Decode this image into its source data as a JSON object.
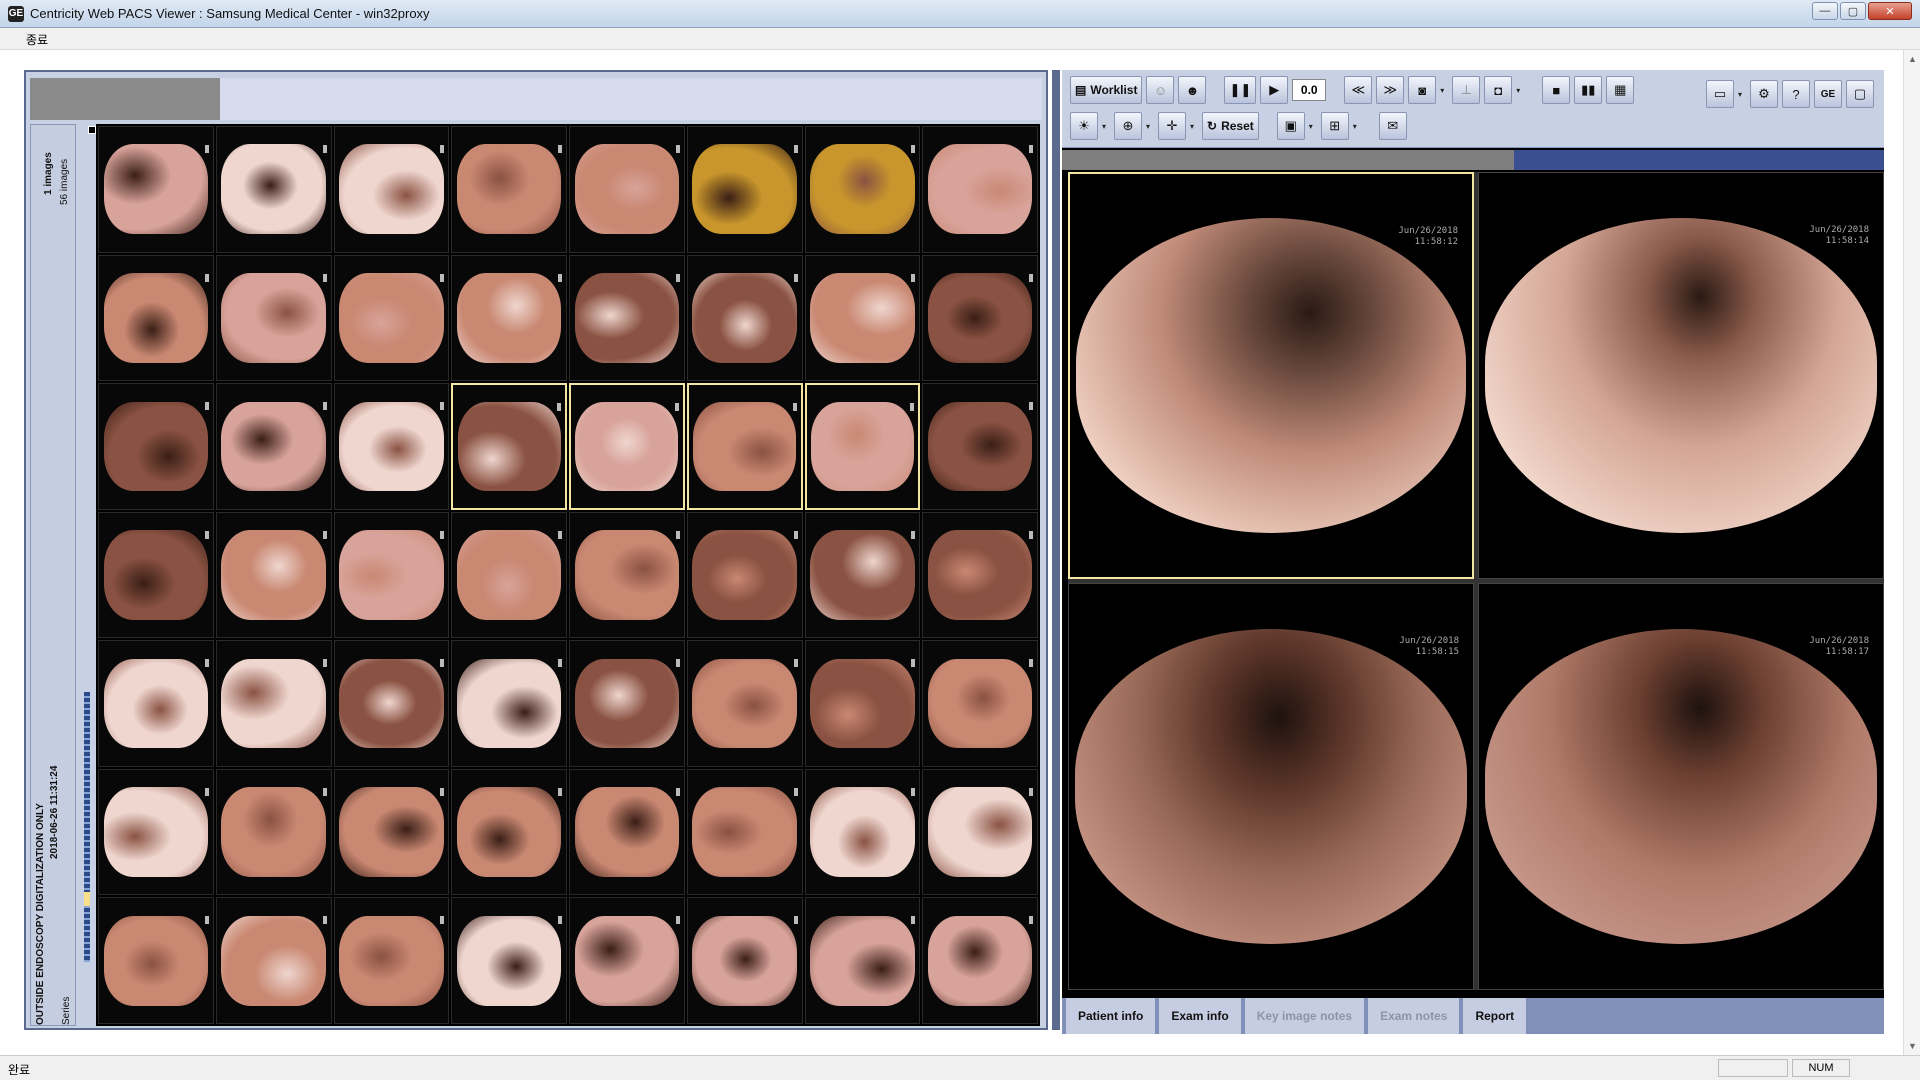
{
  "window": {
    "title": "Centricity Web PACS Viewer : Samsung Medical Center - win32proxy",
    "app_icon": "GE",
    "minimize_icon": "—",
    "maximize_icon": "▢",
    "close_icon": "✕"
  },
  "menu": {
    "items": [
      {
        "label": "종료"
      }
    ]
  },
  "series": {
    "image_count": "1 images",
    "series_count": "56 images",
    "series_label": "Series",
    "description": "OUTSIDE ENDOSCOPY DIGITALIZATION ONLY",
    "datetime": "2018-06-26 11:31:24"
  },
  "thumbnails": {
    "rows": 7,
    "cols": 8,
    "selected_indices": [
      19,
      20,
      21,
      22
    ],
    "palette": {
      "pink": "#d8a39a",
      "salmon": "#c98872",
      "brown": "#8a5242",
      "pale": "#efd6cf",
      "yellow": "#c8962c",
      "dark": "#3a1e16"
    }
  },
  "toolbar": {
    "worklist_label": "Worklist",
    "worklist_icon": "worklist-icon",
    "pause_icon": "❚❚",
    "play_icon": "▶",
    "speed_value": "0.0",
    "rewind_icon": "≪",
    "forward_icon": "≫",
    "reset_label": "Reset",
    "mail_icon": "✉",
    "help_icon": "?",
    "ge_icon": "GE",
    "drop_icon": "▾"
  },
  "progress": {
    "fraction": 0.55
  },
  "viewports": [
    {
      "date": "Jun/26/2018\n11:58:12",
      "active": true
    },
    {
      "date": "Jun/26/2018\n11:58:14",
      "active": false
    },
    {
      "date": "Jun/26/2018\n11:58:15",
      "active": false
    },
    {
      "date": "Jun/26/2018\n11:58:17",
      "active": false
    }
  ],
  "bottom_tabs": [
    {
      "label": "Patient info",
      "enabled": true
    },
    {
      "label": "Exam info",
      "enabled": true
    },
    {
      "label": "Key image notes",
      "enabled": false
    },
    {
      "label": "Exam notes",
      "enabled": false
    },
    {
      "label": "Report",
      "enabled": true
    }
  ],
  "status": {
    "left": "완료",
    "num": "NUM"
  }
}
